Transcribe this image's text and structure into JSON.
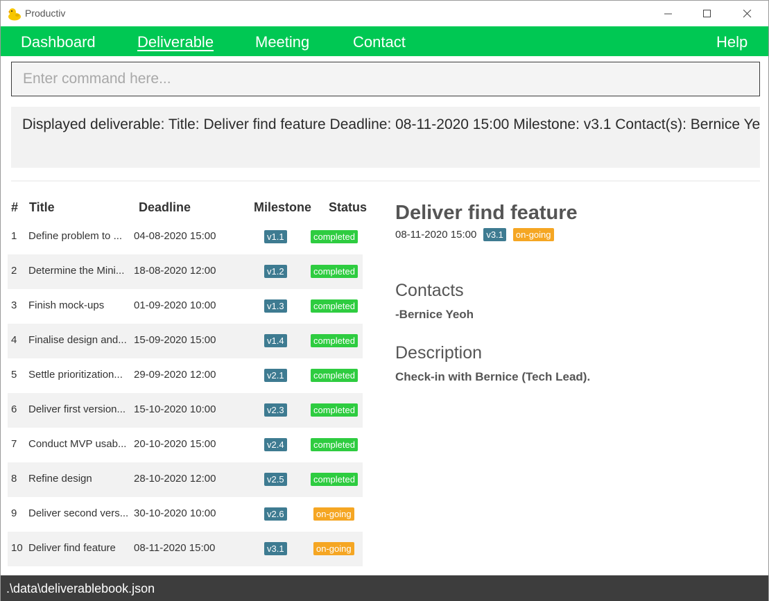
{
  "window": {
    "title": "Productiv",
    "icon": "duck-icon",
    "controls": [
      "minimize-icon",
      "maximize-icon",
      "close-icon"
    ]
  },
  "menu": {
    "items": [
      {
        "label": "Dashboard"
      },
      {
        "label": "Deliverable",
        "active": true
      },
      {
        "label": "Meeting"
      },
      {
        "label": "Contact"
      }
    ],
    "help": "Help"
  },
  "command": {
    "placeholder": "Enter command here...",
    "value": ""
  },
  "result": {
    "text": "Displayed deliverable: Title: Deliver find feature Deadline: 08-11-2020 15:00 Milestone: v3.1 Contact(s): Bernice Yeoh De"
  },
  "list": {
    "headers": {
      "index": "#",
      "title": "Title",
      "deadline": "Deadline",
      "milestone": "Milestone",
      "status": "Status"
    },
    "rows": [
      {
        "index": "1",
        "title": "Define problem to ...",
        "deadline": "04-08-2020 15:00",
        "milestone": "v1.1",
        "status": "completed"
      },
      {
        "index": "2",
        "title": "Determine the Mini...",
        "deadline": "18-08-2020 12:00",
        "milestone": "v1.2",
        "status": "completed"
      },
      {
        "index": "3",
        "title": "Finish mock-ups",
        "deadline": "01-09-2020 10:00",
        "milestone": "v1.3",
        "status": "completed"
      },
      {
        "index": "4",
        "title": "Finalise design and...",
        "deadline": "15-09-2020 15:00",
        "milestone": "v1.4",
        "status": "completed"
      },
      {
        "index": "5",
        "title": "Settle prioritization...",
        "deadline": "29-09-2020 12:00",
        "milestone": "v2.1",
        "status": "completed"
      },
      {
        "index": "6",
        "title": "Deliver first version...",
        "deadline": "15-10-2020 10:00",
        "milestone": "v2.3",
        "status": "completed"
      },
      {
        "index": "7",
        "title": "Conduct MVP usab...",
        "deadline": "20-10-2020 15:00",
        "milestone": "v2.4",
        "status": "completed"
      },
      {
        "index": "8",
        "title": "Refine design",
        "deadline": "28-10-2020 12:00",
        "milestone": "v2.5",
        "status": "completed"
      },
      {
        "index": "9",
        "title": "Deliver second vers...",
        "deadline": "30-10-2020 10:00",
        "milestone": "v2.6",
        "status": "on-going"
      },
      {
        "index": "10",
        "title": "Deliver find feature",
        "deadline": "08-11-2020 15:00",
        "milestone": "v3.1",
        "status": "on-going"
      }
    ]
  },
  "detail": {
    "title": "Deliver find feature",
    "deadline": "08-11-2020 15:00",
    "milestone": "v3.1",
    "status": "on-going",
    "contacts_heading": "Contacts",
    "contacts": "-Bernice Yeoh",
    "description_heading": "Description",
    "description": "Check-in with Bernice (Tech Lead)."
  },
  "statusbar": {
    "path": ".\\data\\deliverablebook.json"
  },
  "colors": {
    "menu_bg": "#00c853",
    "milestone_badge": "#3e7b91",
    "completed_badge": "#2ecc40",
    "ongoing_badge": "#f5a623",
    "statusbar_bg": "#3d3d3d"
  }
}
